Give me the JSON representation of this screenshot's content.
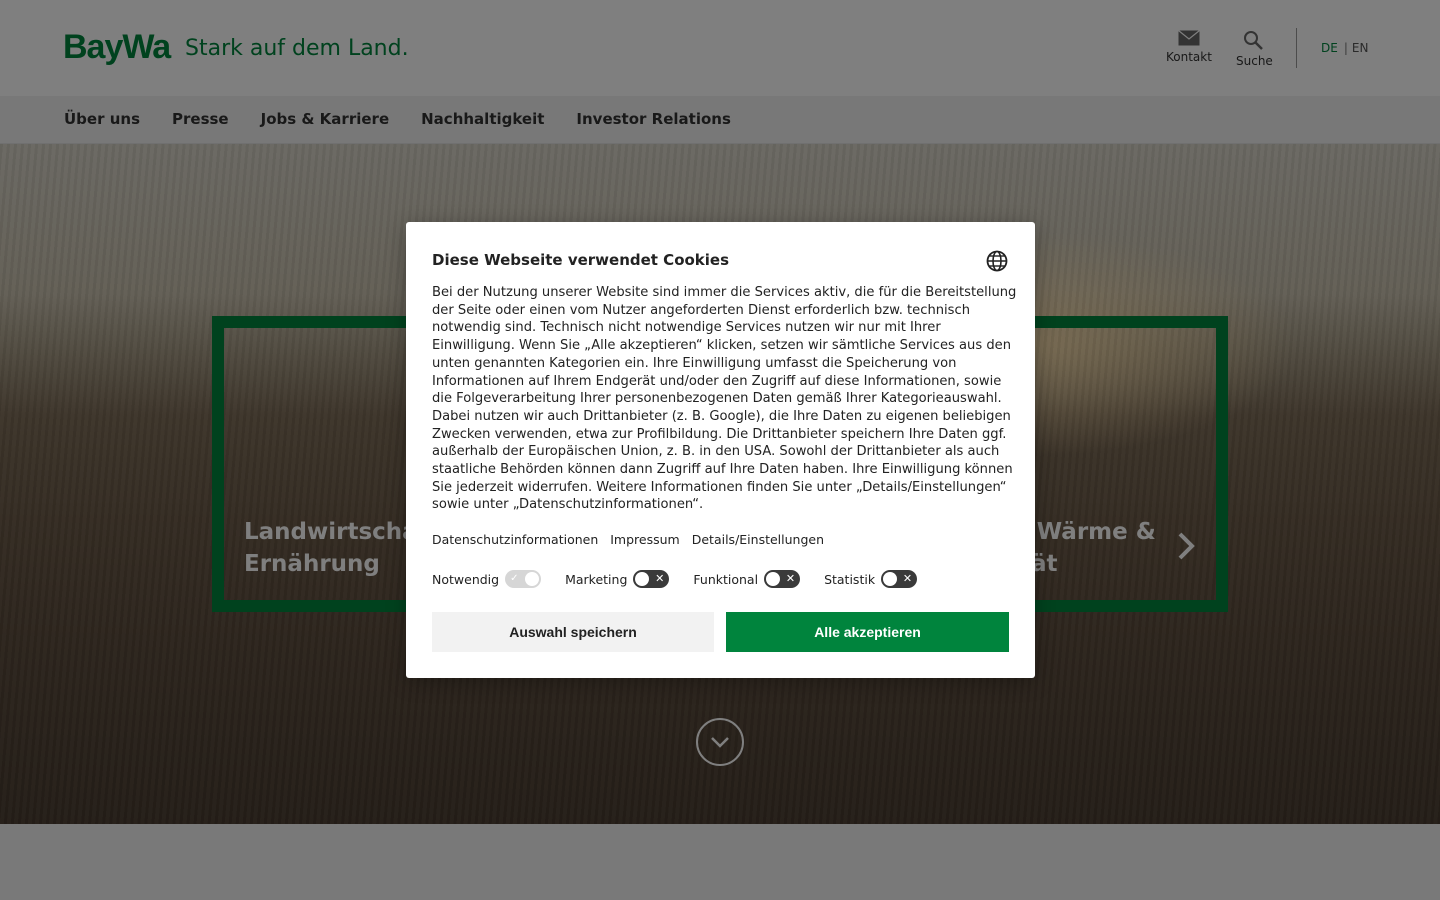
{
  "header": {
    "logo": "BayWa",
    "claim": "Stark auf dem Land.",
    "contact_label": "Kontakt",
    "search_label": "Suche",
    "lang_de": "DE",
    "lang_en": "EN",
    "lang_separator": "|"
  },
  "nav": {
    "items": [
      "Über uns",
      "Presse",
      "Jobs & Karriere",
      "Nachhaltigkeit",
      "Investor Relations"
    ]
  },
  "hero": {
    "teaser_left_line1": "Landwirtschaft",
    "teaser_left_line2": "Ernährung",
    "teaser_right_line1": ", Wärme &",
    "teaser_right_line2": "tät"
  },
  "cookie": {
    "title": "Diese Webseite verwendet Cookies",
    "body": "Bei der Nutzung unserer Website sind immer die Services aktiv, die für die Bereitstellung der Seite oder einen vom Nutzer angeforderten Dienst erforderlich bzw. technisch notwendig sind. Technisch nicht notwendige Services nutzen wir nur mit Ihrer Einwilligung. Wenn Sie „Alle akzeptieren“ klicken, setzen wir sämtliche Services aus den unten genannten Kategorien ein. Ihre Einwilligung umfasst die Speicherung von Informationen auf Ihrem Endgerät und/oder den Zugriff auf diese Informationen, sowie die Folgeverarbeitung Ihrer personenbezogenen Daten gemäß Ihrer Kategorieauswahl. Dabei nutzen wir auch Drittanbieter (z. B. Google), die Ihre Daten zu eigenen beliebigen Zwecken verwenden, etwa zur Profilbildung. Die Drittanbieter speichern Ihre Daten ggf. außerhalb der Europäischen Union, z. B. in den USA. Sowohl der Drittanbieter als auch staatliche Behörden können dann Zugriff auf Ihre Daten haben. Ihre Einwilligung können Sie jederzeit widerrufen. Weitere Informationen finden Sie unter „Details/Einstellungen“ sowie unter „Datenschutzinformationen“.",
    "links": [
      "Datenschutzinformationen",
      "Impressum",
      "Details/Einstellungen"
    ],
    "toggles": [
      {
        "label": "Notwendig",
        "state": "on-disabled"
      },
      {
        "label": "Marketing",
        "state": "off"
      },
      {
        "label": "Funktional",
        "state": "off"
      },
      {
        "label": "Statistik",
        "state": "off"
      }
    ],
    "save_label": "Auswahl speichern",
    "accept_label": "Alle akzeptieren"
  },
  "colors": {
    "brand": "#00843d",
    "overlay": "rgba(0,0,0,0.5)"
  },
  "icons": [
    "mail-icon",
    "search-icon",
    "globe-icon",
    "chevron-right-icon",
    "chevron-down-icon"
  ]
}
